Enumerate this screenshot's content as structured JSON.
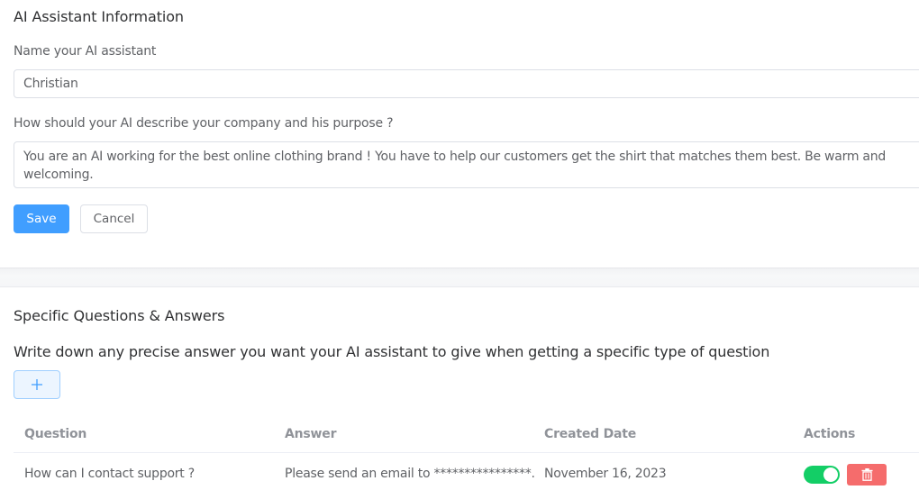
{
  "assistant_info": {
    "title": "AI Assistant Information",
    "name_label": "Name your AI assistant",
    "name_value": "Christian",
    "description_label": "How should your AI describe your company and his purpose ?",
    "description_value": "You are an AI working for the best online clothing brand ! You have to help our customers get the shirt that matches them best. Be warm and welcoming.",
    "save_label": "Save",
    "cancel_label": "Cancel"
  },
  "qa": {
    "title": "Specific Questions & Answers",
    "description": "Write down any precise answer you want your AI assistant to give when getting a specific type of question",
    "add_icon": "plus-icon",
    "columns": [
      "Question",
      "Answer",
      "Created Date",
      "Actions"
    ],
    "rows": [
      {
        "question": "How can I contact support ?",
        "answer": "Please send an email to ****************.",
        "created": "November 16, 2023",
        "enabled": true
      }
    ]
  },
  "colors": {
    "primary": "#409eff",
    "success": "#13ce66",
    "danger": "#f56c6c"
  }
}
